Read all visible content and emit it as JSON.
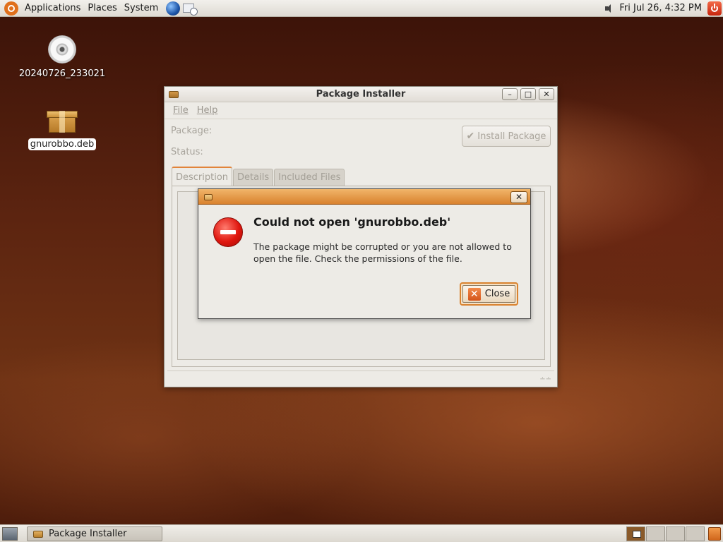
{
  "top_panel": {
    "menus": [
      "Applications",
      "Places",
      "System"
    ],
    "clock": "Fri Jul 26,  4:32 PM"
  },
  "desktop": {
    "icons": [
      {
        "label": "20240726_233021",
        "icon": "cd-icon"
      },
      {
        "label": "gnurobbo.deb",
        "icon": "package-icon"
      }
    ]
  },
  "window": {
    "title": "Package Installer",
    "menu": [
      "File",
      "Help"
    ],
    "package_label": "Package:",
    "status_label": "Status:",
    "install_button": "Install Package",
    "tabs": [
      "Description",
      "Details",
      "Included Files"
    ]
  },
  "dialog": {
    "heading": "Could not open 'gnurobbo.deb'",
    "message": "The package might be corrupted or you are not allowed to open the file. Check the permissions of the file.",
    "close_button": "Close"
  },
  "bottom_panel": {
    "task": "Package Installer"
  },
  "colors": {
    "accent": "#d9822e",
    "error_red": "#e0170f"
  }
}
